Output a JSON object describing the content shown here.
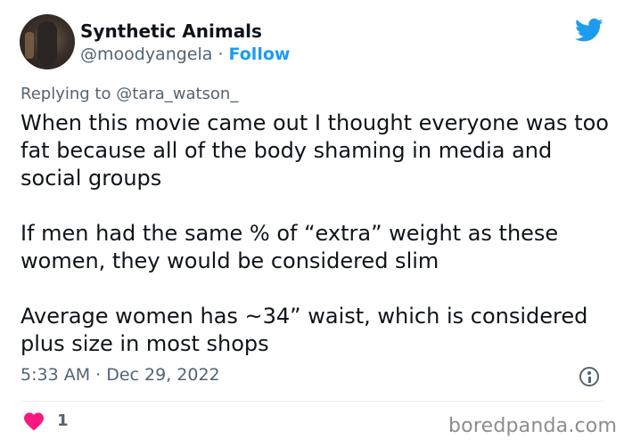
{
  "author": {
    "display_name": "Synthetic Animals",
    "handle": "@moodyangela",
    "separator": " · ",
    "follow_label": "Follow"
  },
  "reply": {
    "prefix": "Replying to ",
    "mention": "@tara_watson_"
  },
  "tweet": {
    "paragraphs": [
      "When this movie came out I thought everyone was too fat because all of the body shaming in media and social groups",
      "If men had the same % of “extra” weight as these women, they would be considered slim",
      "Average women has ~34” waist, which is considered plus size in most shops"
    ],
    "timestamp": "5:33 AM · Dec 29, 2022"
  },
  "engagement": {
    "likes": "1"
  },
  "watermark": "boredpanda.com",
  "icons": {
    "brand": "twitter-bird-icon",
    "info": "info-icon",
    "like": "heart-icon"
  },
  "colors": {
    "accent": "#1d9bf0",
    "heart": "#f91880",
    "muted_text": "#536471",
    "text": "#0f1419"
  }
}
